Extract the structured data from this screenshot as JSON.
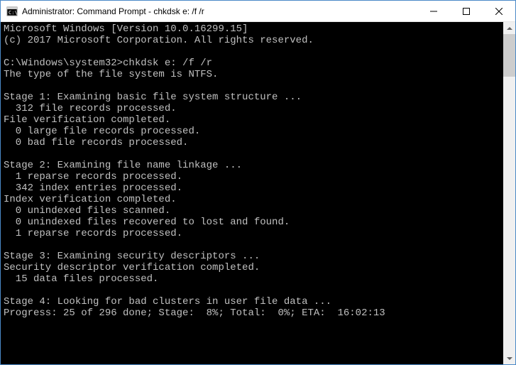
{
  "titlebar": {
    "title": "Administrator: Command Prompt - chkdsk  e: /f /r"
  },
  "terminal": {
    "lines": [
      "Microsoft Windows [Version 10.0.16299.15]",
      "(c) 2017 Microsoft Corporation. All rights reserved.",
      "",
      "C:\\Windows\\system32>chkdsk e: /f /r",
      "The type of the file system is NTFS.",
      "",
      "Stage 1: Examining basic file system structure ...",
      "  312 file records processed.",
      "File verification completed.",
      "  0 large file records processed.",
      "  0 bad file records processed.",
      "",
      "Stage 2: Examining file name linkage ...",
      "  1 reparse records processed.",
      "  342 index entries processed.",
      "Index verification completed.",
      "  0 unindexed files scanned.",
      "  0 unindexed files recovered to lost and found.",
      "  1 reparse records processed.",
      "",
      "Stage 3: Examining security descriptors ...",
      "Security descriptor verification completed.",
      "  15 data files processed.",
      "",
      "Stage 4: Looking for bad clusters in user file data ...",
      "Progress: 25 of 296 done; Stage:  8%; Total:  0%; ETA:  16:02:13"
    ]
  }
}
